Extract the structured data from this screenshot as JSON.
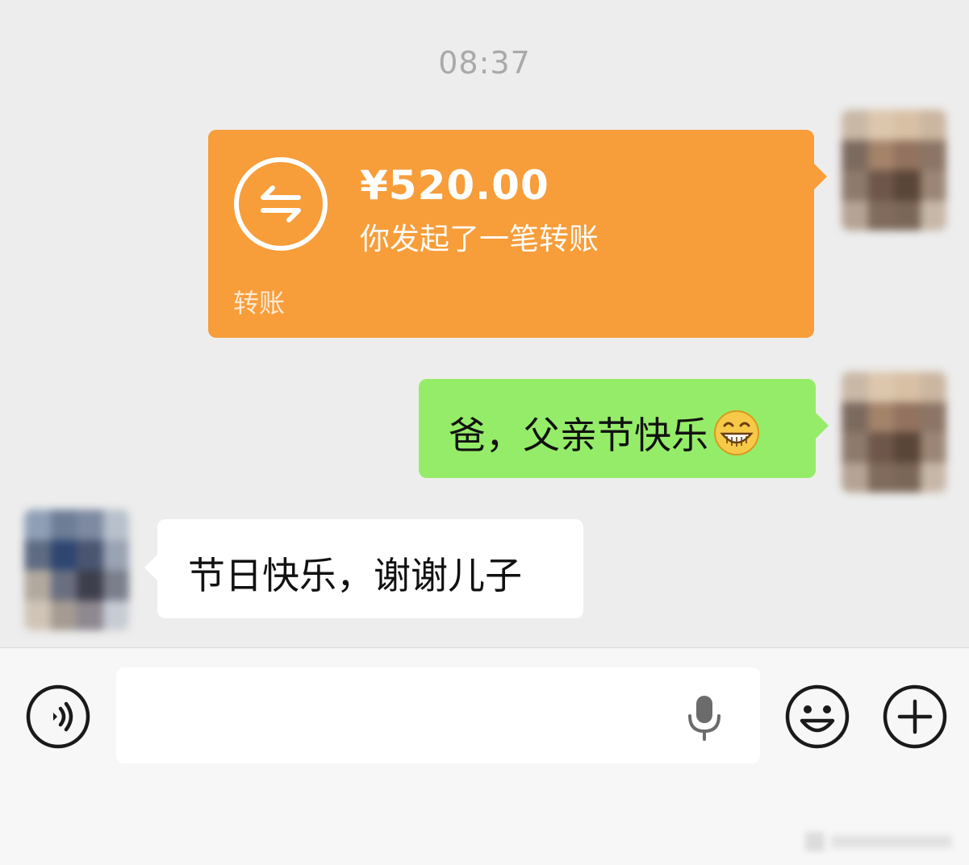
{
  "chat": {
    "timestamp": "08:37",
    "transfer": {
      "amount": "¥520.00",
      "description": "你发起了一笔转账",
      "label": "转账"
    },
    "sent_message": {
      "text": "爸，父亲节快乐",
      "emoji": "grin-emoji"
    },
    "received_message": {
      "text": "节日快乐，谢谢儿子"
    }
  },
  "input_bar": {
    "voice_icon": "voice-icon",
    "input_value": "",
    "mic_icon": "mic-icon",
    "emoji_icon": "smiley-icon",
    "more_icon": "plus-icon"
  },
  "colors": {
    "background": "#ededed",
    "transfer_bubble": "#f79d3a",
    "sent_bubble": "#95ec69",
    "received_bubble": "#ffffff",
    "timestamp": "#a9a9a9"
  }
}
